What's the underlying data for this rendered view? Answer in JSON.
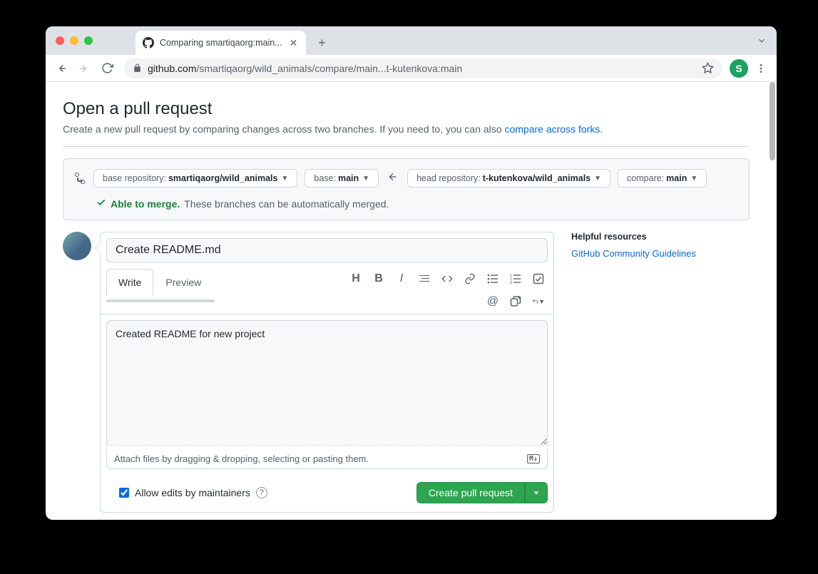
{
  "browser": {
    "tab_title": "Comparing smartiqaorg:main...",
    "url_domain": "github.com",
    "url_path": "/smartiqaorg/wild_animals/compare/main...t-kutenkova:main",
    "avatar_letter": "S"
  },
  "page": {
    "heading": "Open a pull request",
    "subtext_a": "Create a new pull request by comparing changes across two branches. If you need to, you can also ",
    "subtext_link": "compare across forks",
    "subtext_b": "."
  },
  "compare": {
    "base_repo_label": "base repository: ",
    "base_repo_value": "smartiqaorg/wild_animals",
    "base_label": "base: ",
    "base_value": "main",
    "head_repo_label": "head repository: ",
    "head_repo_value": "t-kutenkova/wild_animals",
    "compare_label": "compare: ",
    "compare_value": "main",
    "merge_ok_title": "Able to merge.",
    "merge_ok_desc": "These branches can be automatically merged."
  },
  "form": {
    "title_value": "Create README.md",
    "tab_write": "Write",
    "tab_preview": "Preview",
    "body_value": "Created README for new project",
    "attach_hint": "Attach files by dragging & dropping, selecting or pasting them.",
    "allow_edits_label": "Allow edits by maintainers",
    "submit_label": "Create pull request"
  },
  "sidebar": {
    "help_heading": "Helpful resources",
    "help_link": "GitHub Community Guidelines"
  }
}
